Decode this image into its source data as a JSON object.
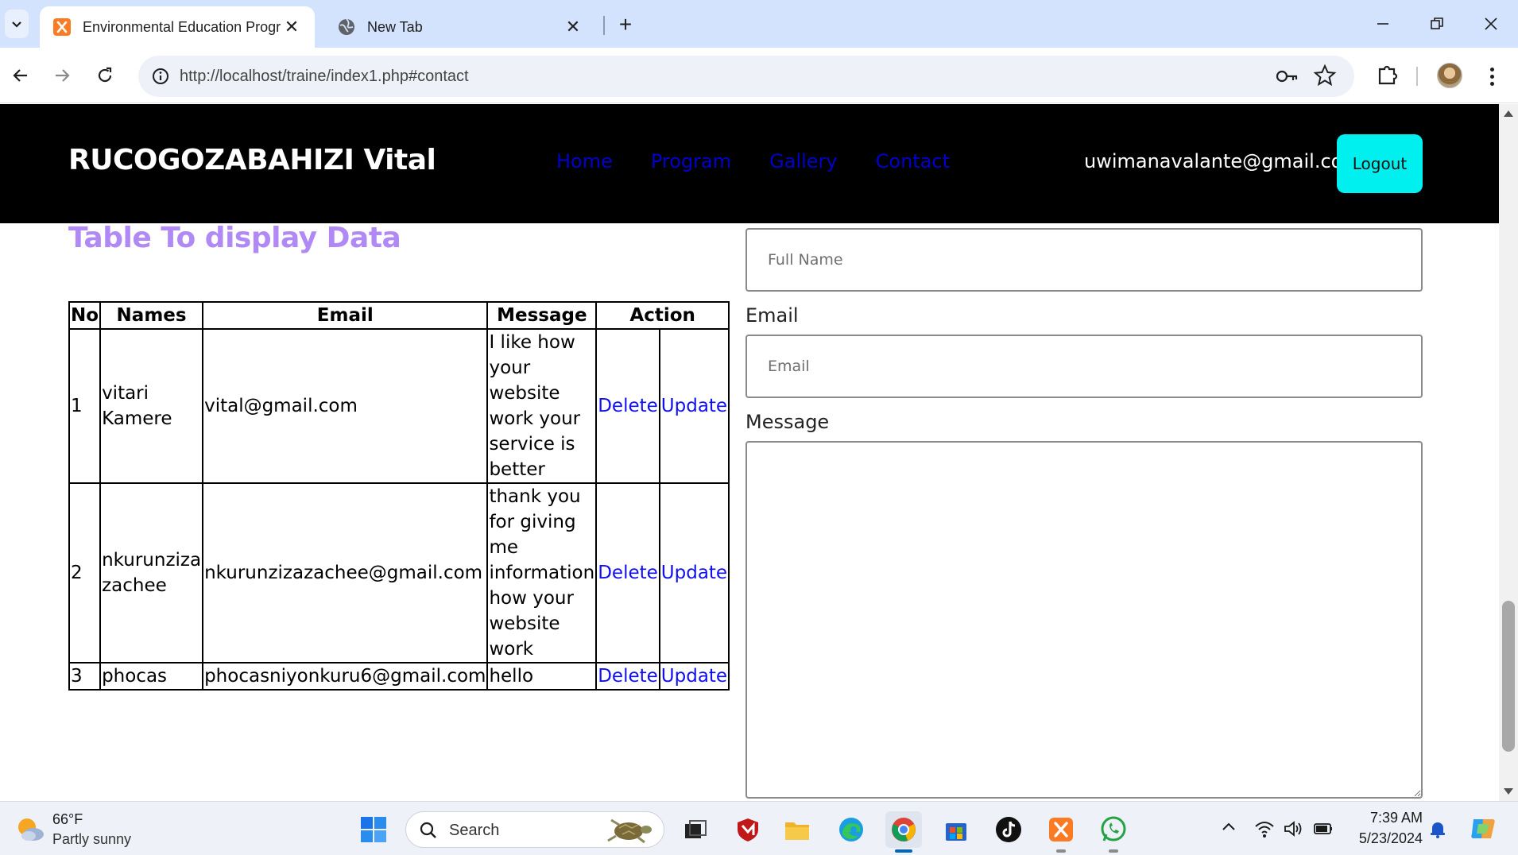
{
  "browser": {
    "tabs": [
      {
        "title": "Environmental Education Progra",
        "active": true
      },
      {
        "title": "New Tab",
        "active": false
      }
    ],
    "url": "http://localhost/traine/index1.php#contact"
  },
  "site": {
    "brand": "RUCOGOZABAHIZI Vital",
    "nav": [
      "Home",
      "Program",
      "Gallery",
      "Contact"
    ],
    "user_email": "uwimanavalante@gmail.com",
    "logout_label": "Logout",
    "nav_link_color": "#0000cc",
    "header_bg": "#000000",
    "logout_bg": "#00f0f0"
  },
  "table_section": {
    "title": "Table To display Data",
    "title_color": "#b189f5",
    "headers": [
      "No",
      "Names",
      "Email",
      "Message",
      "Action"
    ],
    "rows": [
      {
        "no": "1",
        "name_lines": [
          "vitari",
          "Kamere"
        ],
        "email": "vital@gmail.com",
        "message_lines": [
          "I like how",
          "your",
          "website",
          "work your",
          "service is",
          "better"
        ],
        "delete": "Delete",
        "update": "Update"
      },
      {
        "no": "2",
        "name_lines": [
          "nkurunziza",
          "zachee"
        ],
        "email": "nkurunzizazachee@gmail.com",
        "message_lines": [
          "thank you",
          "for giving",
          "me",
          "information",
          "how your",
          "website",
          "work"
        ],
        "delete": "Delete",
        "update": "Update"
      },
      {
        "no": "3",
        "name_lines": [
          "phocas"
        ],
        "email": "phocasniyonkuru6@gmail.com",
        "message_lines": [
          "hello"
        ],
        "delete": "Delete",
        "update": "Update"
      }
    ]
  },
  "contact_form": {
    "full_name_placeholder": "Full Name",
    "email_label": "Email",
    "email_placeholder": "Email",
    "message_label": "Message"
  },
  "taskbar": {
    "weather_temp": "66°F",
    "weather_desc": "Partly sunny",
    "search_placeholder": "Search",
    "time": "7:39 AM",
    "date": "5/23/2024"
  }
}
